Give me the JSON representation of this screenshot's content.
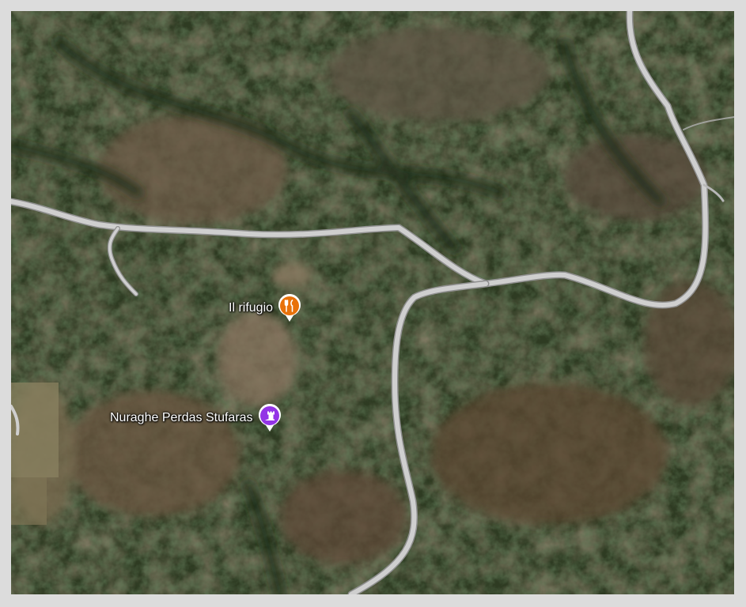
{
  "map": {
    "view": "satellite",
    "places": [
      {
        "name": "Il rifugio",
        "category": "restaurant",
        "icon": "fork-knife-icon",
        "color": "#E8710A"
      },
      {
        "name": "Nuraghe Perdas Stufaras",
        "category": "historical-landmark",
        "icon": "castle-icon",
        "color": "#9334E6"
      }
    ],
    "colors": {
      "road": "#c9c9c9",
      "road_edge": "#9a9a9a",
      "frame": "#dcdcdc"
    }
  }
}
